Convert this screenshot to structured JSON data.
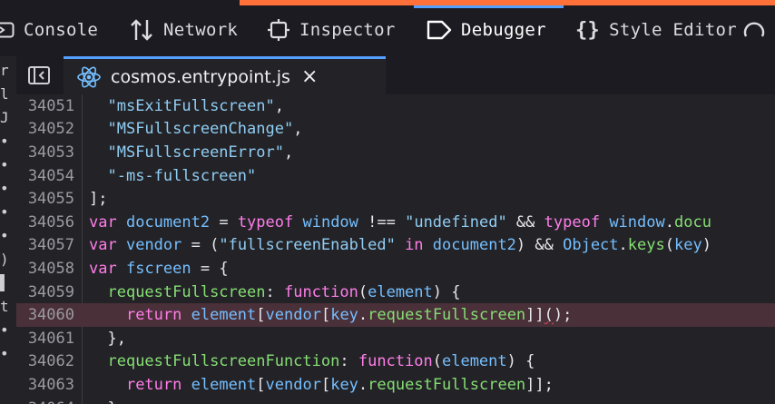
{
  "toolbar": {
    "tabs": [
      {
        "id": "console",
        "label": "Console",
        "icon": "console-icon"
      },
      {
        "id": "network",
        "label": "Network",
        "icon": "network-icon"
      },
      {
        "id": "inspector",
        "label": "Inspector",
        "icon": "inspector-icon"
      },
      {
        "id": "debugger",
        "label": "Debugger",
        "icon": "debugger-icon",
        "active": true
      },
      {
        "id": "style-editor",
        "label": "Style Editor",
        "icon": "braces-icon"
      }
    ],
    "accent_color": "#ff7139",
    "selected_color": "#54a0ff"
  },
  "left_strip": {
    "glyphs": [
      "r",
      "l",
      "J",
      "•",
      "•",
      "•",
      "•",
      "•",
      ")",
      "▌",
      "t",
      "•",
      "•"
    ]
  },
  "source_tab": {
    "filename": "cosmos.entrypoint.js",
    "close_glyph": "×",
    "icon": "react-icon"
  },
  "editor": {
    "highlighted_line": 34060,
    "lines": [
      {
        "n": "34051",
        "tokens": [
          [
            "plain",
            "  "
          ],
          [
            "str",
            "\"msExitFullscreen\""
          ],
          [
            "plain",
            ","
          ]
        ]
      },
      {
        "n": "34052",
        "tokens": [
          [
            "plain",
            "  "
          ],
          [
            "str",
            "\"MSFullscreenChange\""
          ],
          [
            "plain",
            ","
          ]
        ]
      },
      {
        "n": "34053",
        "tokens": [
          [
            "plain",
            "  "
          ],
          [
            "str",
            "\"MSFullscreenError\""
          ],
          [
            "plain",
            ","
          ]
        ]
      },
      {
        "n": "34054",
        "tokens": [
          [
            "plain",
            "  "
          ],
          [
            "str",
            "\"-ms-fullscreen\""
          ]
        ]
      },
      {
        "n": "34055",
        "tokens": [
          [
            "plain",
            "];"
          ]
        ]
      },
      {
        "n": "34056",
        "tokens": [
          [
            "kw",
            "var"
          ],
          [
            "plain",
            " "
          ],
          [
            "var",
            "document2"
          ],
          [
            "plain",
            " = "
          ],
          [
            "kw",
            "typeof"
          ],
          [
            "plain",
            " "
          ],
          [
            "var",
            "window"
          ],
          [
            "plain",
            " !== "
          ],
          [
            "str",
            "\"undefined\""
          ],
          [
            "plain",
            " && "
          ],
          [
            "kw",
            "typeof"
          ],
          [
            "plain",
            " "
          ],
          [
            "var",
            "window"
          ],
          [
            "plain",
            "."
          ],
          [
            "id",
            "docu"
          ]
        ]
      },
      {
        "n": "34057",
        "tokens": [
          [
            "kw",
            "var"
          ],
          [
            "plain",
            " "
          ],
          [
            "var",
            "vendor"
          ],
          [
            "plain",
            " = ("
          ],
          [
            "str",
            "\"fullscreenEnabled\""
          ],
          [
            "plain",
            " "
          ],
          [
            "kw",
            "in"
          ],
          [
            "plain",
            " "
          ],
          [
            "var",
            "document2"
          ],
          [
            "plain",
            ") && "
          ],
          [
            "var",
            "Object"
          ],
          [
            "plain",
            "."
          ],
          [
            "id",
            "keys"
          ],
          [
            "plain",
            "("
          ],
          [
            "var",
            "key"
          ],
          [
            "plain",
            ")"
          ]
        ]
      },
      {
        "n": "34058",
        "tokens": [
          [
            "kw",
            "var"
          ],
          [
            "plain",
            " "
          ],
          [
            "var",
            "fscreen"
          ],
          [
            "plain",
            " = {"
          ]
        ]
      },
      {
        "n": "34059",
        "tokens": [
          [
            "plain",
            "  "
          ],
          [
            "id",
            "requestFullscreen"
          ],
          [
            "plain",
            ": "
          ],
          [
            "kw",
            "function"
          ],
          [
            "plain",
            "("
          ],
          [
            "var",
            "element"
          ],
          [
            "plain",
            ") {"
          ]
        ]
      },
      {
        "n": "34060",
        "tokens": [
          [
            "plain",
            "    "
          ],
          [
            "kw",
            "return"
          ],
          [
            "plain",
            " "
          ],
          [
            "var",
            "element"
          ],
          [
            "plain",
            "["
          ],
          [
            "var",
            "vendor"
          ],
          [
            "plain",
            "["
          ],
          [
            "var",
            "key"
          ],
          [
            "plain",
            "."
          ],
          [
            "id",
            "requestFullscreen"
          ],
          [
            "plain",
            "]]"
          ],
          [
            "squig",
            "("
          ],
          [
            "plain",
            ");"
          ]
        ]
      },
      {
        "n": "34061",
        "tokens": [
          [
            "plain",
            "  },"
          ]
        ]
      },
      {
        "n": "34062",
        "tokens": [
          [
            "plain",
            "  "
          ],
          [
            "id",
            "requestFullscreenFunction"
          ],
          [
            "plain",
            ": "
          ],
          [
            "kw",
            "function"
          ],
          [
            "plain",
            "("
          ],
          [
            "var",
            "element"
          ],
          [
            "plain",
            ") {"
          ]
        ]
      },
      {
        "n": "34063",
        "tokens": [
          [
            "plain",
            "    "
          ],
          [
            "kw",
            "return"
          ],
          [
            "plain",
            " "
          ],
          [
            "var",
            "element"
          ],
          [
            "plain",
            "["
          ],
          [
            "var",
            "vendor"
          ],
          [
            "plain",
            "["
          ],
          [
            "var",
            "key"
          ],
          [
            "plain",
            "."
          ],
          [
            "id",
            "requestFullscreen"
          ],
          [
            "plain",
            "]];"
          ]
        ]
      },
      {
        "n": "34064",
        "tokens": [
          [
            "plain",
            "  },"
          ]
        ]
      }
    ]
  }
}
